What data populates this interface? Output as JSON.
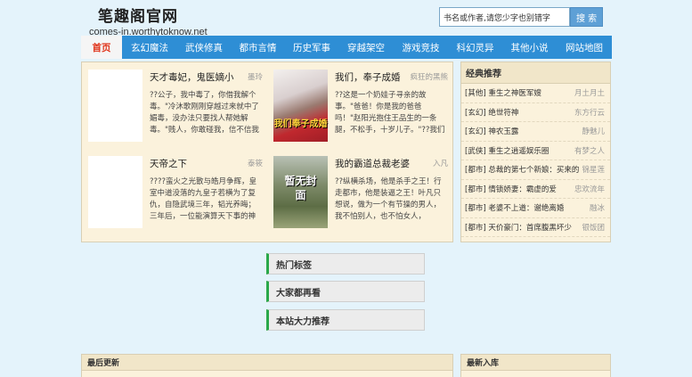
{
  "header": {
    "site_name": "笔趣阁官网",
    "domain": "comes-in.worthytoknow.net"
  },
  "search": {
    "placeholder": "书名或作者,请您少字也别错字",
    "button_label": "搜 索"
  },
  "nav": {
    "items": [
      "首页",
      "玄幻魔法",
      "武侠修真",
      "都市言情",
      "历史军事",
      "穿越架空",
      "游戏竞技",
      "科幻灵异",
      "其他小说",
      "网站地图"
    ]
  },
  "featured": [
    {
      "title": "天才毒妃，鬼医嫡小",
      "author": "墨玲",
      "desc": "??公子，我中毒了，你借我解个毒。\"冷沐歌刚刚穿越过来就中了媚毒，没办法只要找人帮她解毒。\"贱人，你敢碰我，信不信我杀了你。\"身受箭伤的男子看着她。\"没"
    },
    {
      "title": "我们，奉子成婚",
      "author": "疯狂的黑熊",
      "desc": "??这是一个奶娃子寻亲的故事。\"爸爸！你是我的爸爸吗！\"赵阳光抱住王品生的一条腿，不松手，十岁儿子。\"??我们终于重逢了！\"王品生一低头，主提着温文尔雅的笑容，\"小",
      "cover_text": "我们奉子成婚"
    },
    {
      "title": "天帝之下",
      "author": "泰筱",
      "desc": "????蛮火之光散与皓月争辉，皇室中道没落的九皇子若横为了复仇，自隐武境三年，韬光养晦；三年后，一位能演算天下事的神秘国相助其龙腾东山；他身赋一神秘祭"
    },
    {
      "title": "我的霸道总裁老婆",
      "author": "入凡",
      "desc": "??纵横杀场，他是杀手之王！行走都市，他是装逼之王！叶凡只想说，做为一个有节操的男人，我不怕别人，也不怕女人，嗯……",
      "cover_text": "暂无封面"
    }
  ],
  "side": {
    "heading": "经典推荐",
    "rows": [
      {
        "title": "[其他] 重生之神医军嫂",
        "author": "月土月土"
      },
      {
        "title": "[玄幻] 绝世符神",
        "author": "东方行云"
      },
      {
        "title": "[玄幻] 神农玉露",
        "author": "静魅儿"
      },
      {
        "title": "[武侠] 重生之逍遥娱乐圈",
        "author": "有梦之人"
      },
      {
        "title": "[都市] 总裁的第七个新娘：买来的妻",
        "author": "锦星莲"
      },
      {
        "title": "[都市] 情锁娇妻：霸虚的爱",
        "author": "忠欢流年"
      },
      {
        "title": "[都市] 老婆不上道：谢绝离婚",
        "author": "融冰"
      },
      {
        "title": "[都市] 天价豪门：首席腹黑坏少",
        "author": "银饭团"
      }
    ]
  },
  "tags": {
    "hot_tags": "热门标签",
    "others_read": "大家都再看",
    "recommend": "本站大力推荐"
  },
  "bottom": {
    "latest_updates": "最后更新",
    "new_entries": "最新入库"
  },
  "colors": {
    "nav_bg": "#2e8ed5",
    "active_nav_text": "#e0341a",
    "panel_bg": "#fbf2dc",
    "accent_green": "#2aa84a"
  }
}
